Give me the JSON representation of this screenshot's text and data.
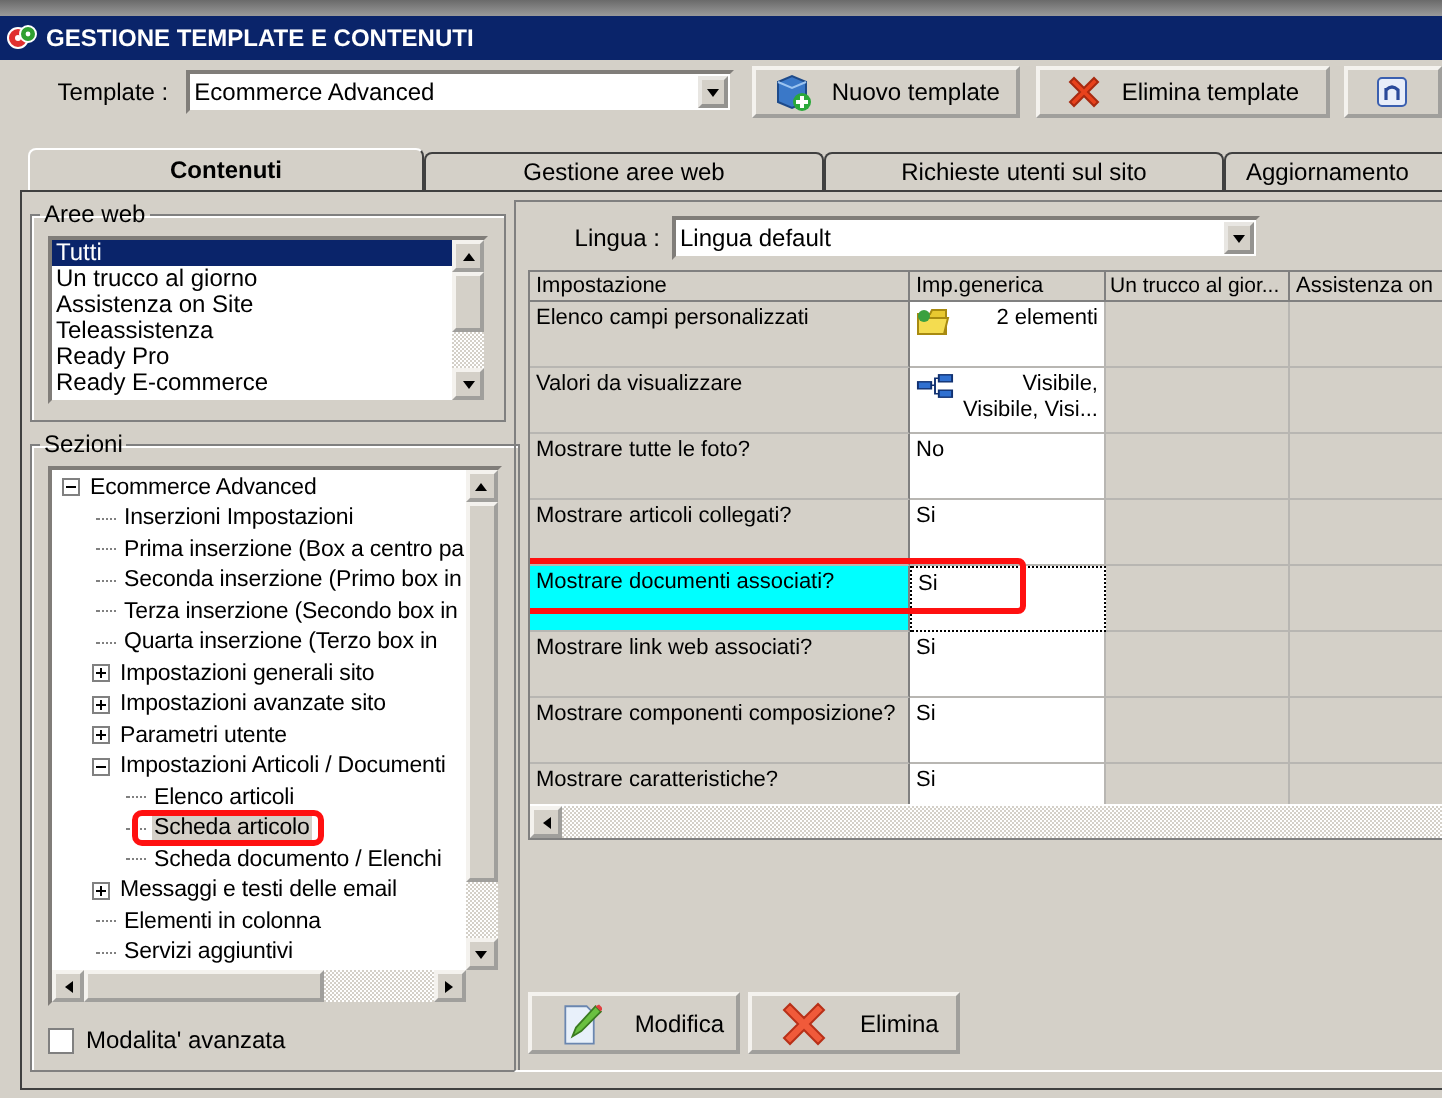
{
  "window": {
    "title": "GESTIONE TEMPLATE E CONTENUTI"
  },
  "template": {
    "label": "Template :",
    "value": "Ecommerce Advanced"
  },
  "toolbar_buttons": [
    {
      "kind": "new",
      "label": "Nuovo template"
    },
    {
      "kind": "delete",
      "label": "Elimina template"
    },
    {
      "kind": "info"
    }
  ],
  "tabs": [
    {
      "label": "Contenuti",
      "selected": true
    },
    {
      "label": "Gestione aree web",
      "selected": false
    },
    {
      "label": "Richieste utenti sul sito",
      "selected": false
    },
    {
      "label": "Aggiornamento",
      "selected": false
    }
  ],
  "aree_web": {
    "title": "Aree web",
    "items": [
      {
        "label": "Tutti",
        "selected": true
      },
      {
        "label": "Un trucco al giorno",
        "selected": false
      },
      {
        "label": "Assistenza on Site",
        "selected": false
      },
      {
        "label": "Teleassistenza",
        "selected": false
      },
      {
        "label": "Ready Pro",
        "selected": false
      },
      {
        "label": "Ready E-commerce",
        "selected": false
      }
    ]
  },
  "sezioni": {
    "title": "Sezioni",
    "tree": [
      {
        "label": "Ecommerce Advanced",
        "expanded": true,
        "selected": false,
        "circled": false,
        "children": [
          {
            "label": "Inserzioni Impostazioni",
            "selected": false,
            "circled": false
          },
          {
            "label": "Prima inserzione (Box a centro pa",
            "selected": false,
            "circled": false
          },
          {
            "label": "Seconda inserzione (Primo box in",
            "selected": false,
            "circled": false
          },
          {
            "label": "Terza inserzione (Secondo box in",
            "selected": false,
            "circled": false
          },
          {
            "label": "Quarta inserzione (Terzo box in",
            "selected": false,
            "circled": false
          },
          {
            "label": "Impostazioni generali sito",
            "expanded": false,
            "selected": false,
            "circled": false
          },
          {
            "label": "Impostazioni avanzate sito",
            "expanded": false,
            "selected": false,
            "circled": false
          },
          {
            "label": "Parametri utente",
            "expanded": false,
            "selected": false,
            "circled": false
          },
          {
            "label": "Impostazioni Articoli / Documenti",
            "expanded": true,
            "selected": false,
            "circled": false,
            "children": [
              {
                "label": "Elenco articoli",
                "selected": false,
                "circled": false
              },
              {
                "label": "Scheda articolo",
                "selected": true,
                "circled": true
              },
              {
                "label": "Scheda documento / Elenchi",
                "selected": false,
                "circled": false
              }
            ]
          },
          {
            "label": "Messaggi e testi delle email",
            "expanded": false,
            "selected": false,
            "circled": false
          },
          {
            "label": "Elementi in colonna",
            "selected": false,
            "circled": false
          },
          {
            "label": "Servizi aggiuntivi",
            "selected": false,
            "circled": false
          }
        ]
      }
    ],
    "advanced_mode": {
      "label": "Modalita' avanzata",
      "checked": false
    }
  },
  "lingua": {
    "label": "Lingua :",
    "value": "Lingua default"
  },
  "grid": {
    "columns": [
      "Impostazione",
      "Imp.generica",
      "Un trucco al gior...",
      "Assistenza on"
    ],
    "rows": [
      {
        "setting": "Elenco campi personalizzati",
        "value": "2 elementi",
        "kind": "folder",
        "selected": false,
        "circled": false
      },
      {
        "setting": "Valori da visualizzare",
        "value": "Visibile, Visibile, Visi...",
        "kind": "tree",
        "selected": false,
        "circled": false
      },
      {
        "setting": "Mostrare tutte le foto?",
        "value": "No",
        "kind": "plain",
        "selected": false,
        "circled": false
      },
      {
        "setting": "Mostrare articoli collegati?",
        "value": "Si",
        "kind": "plain",
        "selected": false,
        "circled": false
      },
      {
        "setting": "Mostrare documenti associati?",
        "value": "Si",
        "kind": "plain",
        "selected": true,
        "circled": true
      },
      {
        "setting": "Mostrare link web associati?",
        "value": "Si",
        "kind": "plain",
        "selected": false,
        "circled": false
      },
      {
        "setting": "Mostrare componenti composizione?",
        "value": "Si",
        "kind": "plain",
        "selected": false,
        "circled": false
      },
      {
        "setting": "Mostrare caratteristiche?",
        "value": "Si",
        "kind": "plain",
        "selected": false,
        "circled": false
      }
    ]
  },
  "actions": [
    {
      "kind": "edit",
      "label": "Modifica"
    },
    {
      "kind": "delete",
      "label": "Elimina"
    }
  ]
}
